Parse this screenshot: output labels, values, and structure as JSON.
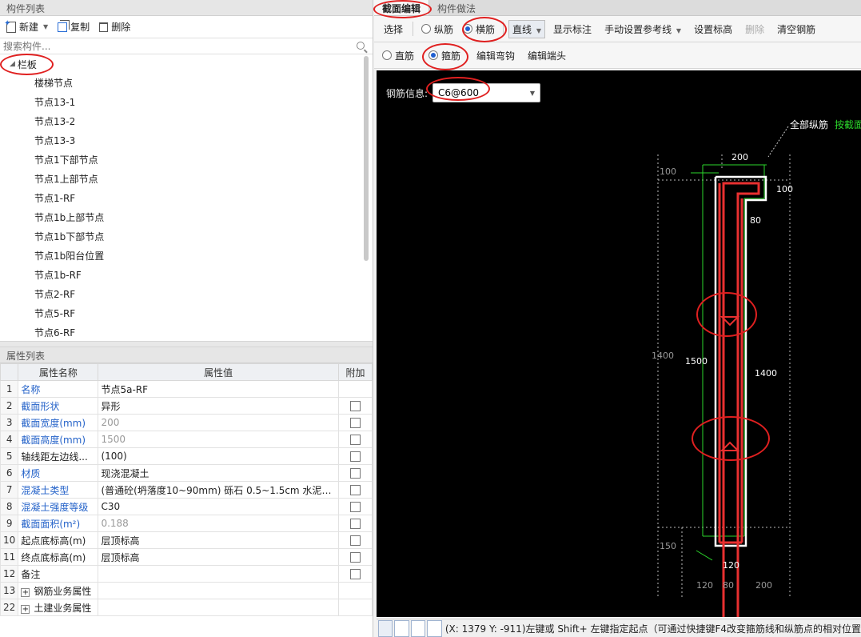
{
  "left": {
    "component_list_title": "构件列表",
    "toolbar": {
      "new": "新建",
      "copy": "复制",
      "delete": "删除"
    },
    "search_placeholder": "搜索构件...",
    "tree": {
      "root": "栏板",
      "items": [
        "楼梯节点",
        "节点13-1",
        "节点13-2",
        "节点13-3",
        "节点1下部节点",
        "节点1上部节点",
        "节点1-RF",
        "节点1b上部节点",
        "节点1b下部节点",
        "节点1b阳台位置",
        "节点1b-RF",
        "节点2-RF",
        "节点5-RF",
        "节点6-RF"
      ]
    },
    "props_title": "属性列表",
    "props_headers": [
      "属性名称",
      "属性值",
      "附加"
    ],
    "props": [
      {
        "n": "1",
        "name": "名称",
        "value": "节点5a-RF",
        "blue": true,
        "grey": false,
        "chk": false
      },
      {
        "n": "2",
        "name": "截面形状",
        "value": "异形",
        "blue": true,
        "grey": false,
        "chk": true
      },
      {
        "n": "3",
        "name": "截面宽度(mm)",
        "value": "200",
        "blue": true,
        "grey": true,
        "chk": true
      },
      {
        "n": "4",
        "name": "截面高度(mm)",
        "value": "1500",
        "blue": true,
        "grey": true,
        "chk": true
      },
      {
        "n": "5",
        "name": "轴线距左边线...",
        "value": "(100)",
        "blue": false,
        "grey": false,
        "chk": true
      },
      {
        "n": "6",
        "name": "材质",
        "value": "现浇混凝土",
        "blue": true,
        "grey": false,
        "chk": true
      },
      {
        "n": "7",
        "name": "混凝土类型",
        "value": "(普通砼(坍落度10~90mm)  砾石 0.5~1.5cm 水泥32...",
        "blue": true,
        "grey": false,
        "chk": true
      },
      {
        "n": "8",
        "name": "混凝土强度等级",
        "value": "C30",
        "blue": true,
        "grey": false,
        "chk": true
      },
      {
        "n": "9",
        "name": "截面面积(m²)",
        "value": "0.188",
        "blue": true,
        "grey": true,
        "chk": true
      },
      {
        "n": "10",
        "name": "起点底标高(m)",
        "value": "层顶标高",
        "blue": false,
        "grey": false,
        "chk": true
      },
      {
        "n": "11",
        "name": "终点底标高(m)",
        "value": "层顶标高",
        "blue": false,
        "grey": false,
        "chk": true
      },
      {
        "n": "12",
        "name": "备注",
        "value": "",
        "blue": false,
        "grey": false,
        "chk": true
      }
    ],
    "groups": [
      {
        "n": "13",
        "name": "钢筋业务属性"
      },
      {
        "n": "22",
        "name": "土建业务属性"
      }
    ]
  },
  "right": {
    "tabs": [
      "截面编辑",
      "构件做法"
    ],
    "toolbar1": {
      "select": "选择",
      "longitudinal": "纵筋",
      "transverse": "横筋",
      "line": "直线",
      "show_dim": "显示标注",
      "ref_line": "手动设置参考线",
      "set_elev": "设置标高",
      "delete": "删除",
      "clear": "清空钢筋"
    },
    "toolbar2": {
      "straight": "直筋",
      "stirrup": "箍筋",
      "edit_hook": "编辑弯钩",
      "edit_end": "编辑端头"
    },
    "rebar_info_label": "钢筋信息:",
    "rebar_info_value": "C6@600",
    "canvas_labels": {
      "all_long": "全部纵筋",
      "by_section": "按截面",
      "d200_top": "200",
      "d100_left": "100",
      "d100_right": "100",
      "d80": "80",
      "d1400_left": "1400",
      "d1500": "1500",
      "d1400_right": "1400",
      "d150": "150",
      "d120_mid": "120",
      "d120_bot": "120",
      "d80_bot": "80",
      "d200_bot": "200"
    },
    "status_text": "(X: 1379 Y: -911)左键或 Shift+ 左键指定起点（可通过快捷键F4改变箍筋线和纵筋点的相对位置"
  },
  "colors": {
    "annotation": "#e02020",
    "rebar": "#e83030",
    "guide": "#2bd62b",
    "outline": "#ffffff"
  }
}
